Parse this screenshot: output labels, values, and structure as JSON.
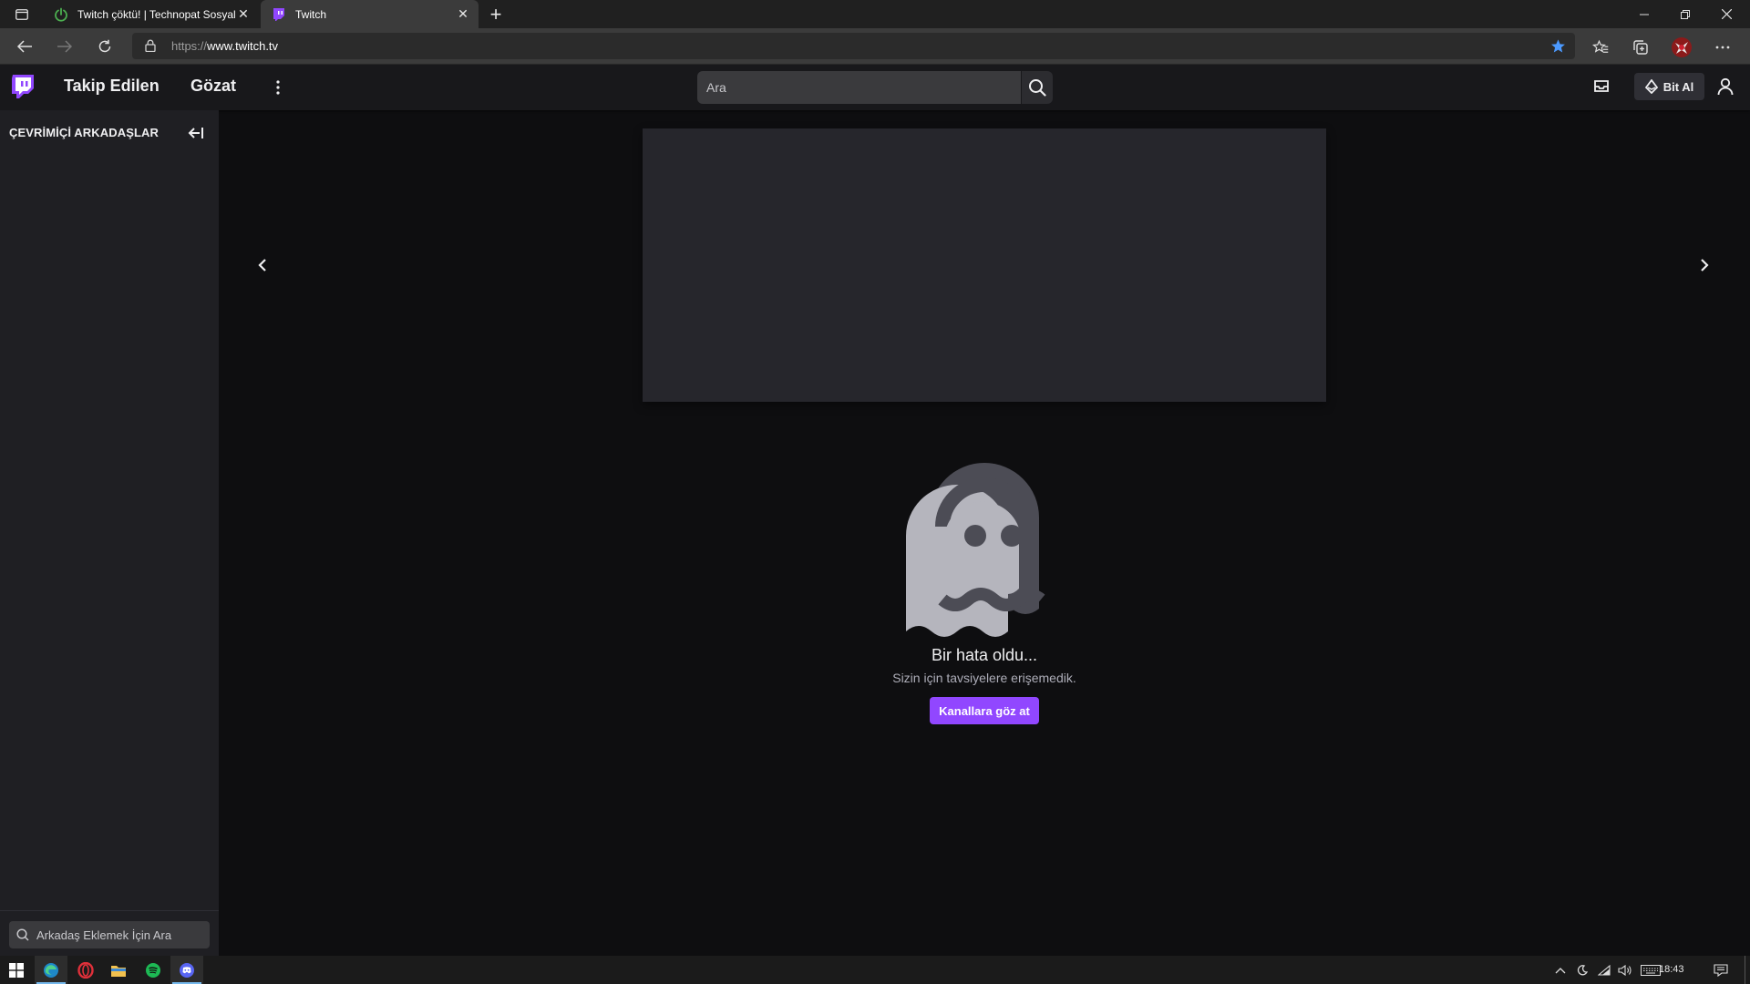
{
  "browser": {
    "tabs": [
      {
        "title": "Twitch çöktü! | Technopat Sosyal",
        "active": false
      },
      {
        "title": "Twitch",
        "active": true
      }
    ],
    "url_prefix": "https://",
    "url_host": "www.twitch.tv"
  },
  "twitch": {
    "nav": {
      "following": "Takip Edilen",
      "browse": "Gözat",
      "search_placeholder": "Ara",
      "bits_label": "Bit Al"
    },
    "sidebar": {
      "heading": "ÇEVRİMİÇİ ARKADAŞLAR",
      "friend_search_placeholder": "Arkadaş Eklemek İçin Ara"
    },
    "error": {
      "title": "Bir hata oldu...",
      "subtitle": "Sizin için tavsiyelere erişemedik.",
      "button": "Kanallara göz at"
    },
    "accent_color": "#9147ff"
  },
  "taskbar": {
    "clock": "18:43"
  }
}
